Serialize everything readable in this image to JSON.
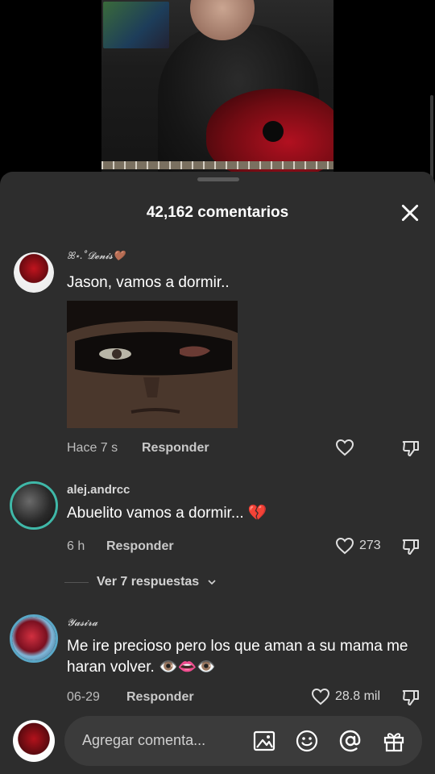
{
  "header": {
    "title": "42,162 comentarios",
    "close_icon": "close-icon"
  },
  "comments": [
    {
      "username": "ꕤ⋆.˚𝓓𝓮𝓷𝓲𝓼🤎",
      "text": "Jason, vamos a dormir..",
      "has_image": true,
      "time": "Hace 7 s",
      "reply_label": "Responder",
      "likes": ""
    },
    {
      "username": "alej.andrcc",
      "text": "Abuelito vamos a dormir... 💔",
      "time": "6 h",
      "reply_label": "Responder",
      "likes": "273",
      "view_replies": "Ver 7 respuestas"
    },
    {
      "username": "𝓨𝓪𝓼𝓲𝓻𝓪",
      "text": "Me ire precioso pero los que aman a su mama me haran volver. 👁️👄👁️",
      "time": "06-29",
      "reply_label": "Responder",
      "likes": "28.8 mil"
    }
  ],
  "input": {
    "placeholder": "Agregar comenta...",
    "icons": [
      "image-icon",
      "emoji-icon",
      "mention-icon",
      "gift-icon"
    ]
  },
  "colors": {
    "sheet_background": "#2d2d2d",
    "input_background": "#3b3b3b",
    "broken_heart": "#e8324a"
  }
}
